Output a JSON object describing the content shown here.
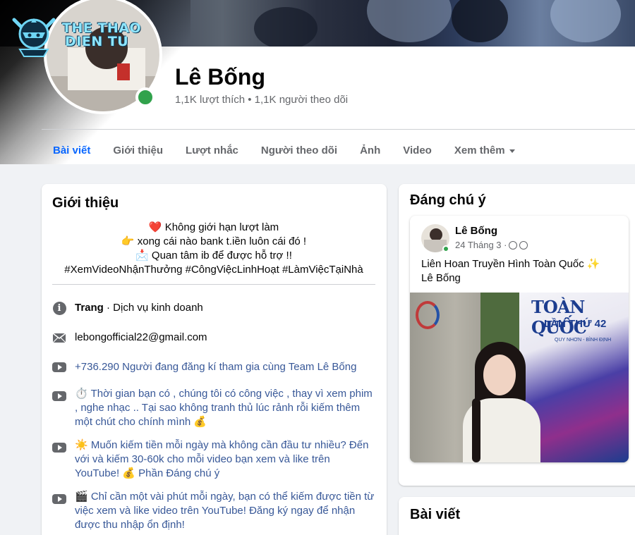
{
  "watermark": {
    "text_line1": "THE THAO",
    "text_line2": "DIEN TU"
  },
  "profile": {
    "name": "Lê Bống",
    "stats": "1,1K lượt thích • 1,1K người theo dõi"
  },
  "tabs": [
    {
      "label": "Bài viết",
      "active": true
    },
    {
      "label": "Giới thiệu"
    },
    {
      "label": "Lượt nhắc"
    },
    {
      "label": "Người theo dõi"
    },
    {
      "label": "Ảnh"
    },
    {
      "label": "Video"
    },
    {
      "label": "Xem thêm"
    }
  ],
  "intro": {
    "title": "Giới thiệu",
    "bio_lines": [
      "❤️ Không giới hạn lượt làm",
      "👉 xong cái nào bank t.iền luôn cái đó !",
      "📩 Quan tâm ib để được hỗ trợ !!",
      "#XemVideoNhậnThưởng #CôngViệcLinhHoạt #LàmViệcTạiNhà"
    ],
    "category_bold": "Trang",
    "category_rest": " · Dịch vụ kinh doanh",
    "email": "lebongofficial22@gmail.com",
    "links": [
      "+736.290 Người đang đăng kí tham gia cùng Team Lê Bống",
      "⏱️ Thời gian bạn có , chúng tôi có công việc , thay vì xem phim , nghe nhạc .. Tại sao không tranh thủ lúc rảnh rỗi kiếm thêm một chút cho chính mình 💰",
      "☀️ Muốn kiếm tiền mỗi ngày mà không cần đầu tư nhiều? Đến với và kiếm 30-60k cho mỗi video bạn xem và like trên YouTube! 💰 Phần Đáng chú ý",
      "🎬 Chỉ cần một vài phút mỗi ngày, bạn có thể kiếm được tiền từ việc xem và like video trên YouTube! Đăng ký ngay để nhận được thu nhập ổn định!"
    ]
  },
  "notable": {
    "title": "Đáng chú ý",
    "post": {
      "author": "Lê Bống",
      "date": "24 Tháng 3 ·",
      "text_line1": "Liên Hoan Truyền Hình Toàn Quốc ✨",
      "text_line2": "Lê Bống",
      "image_text1": "TOÀN QUỐC",
      "image_text2": "LẦN THỨ 42",
      "image_text3": "QUY NHƠN - BÌNH ĐỊNH"
    }
  },
  "posts": {
    "title": "Bài viết"
  },
  "colors": {
    "accent": "#0866ff",
    "link": "#385898",
    "online": "#31a24c",
    "muted": "#65676b"
  }
}
